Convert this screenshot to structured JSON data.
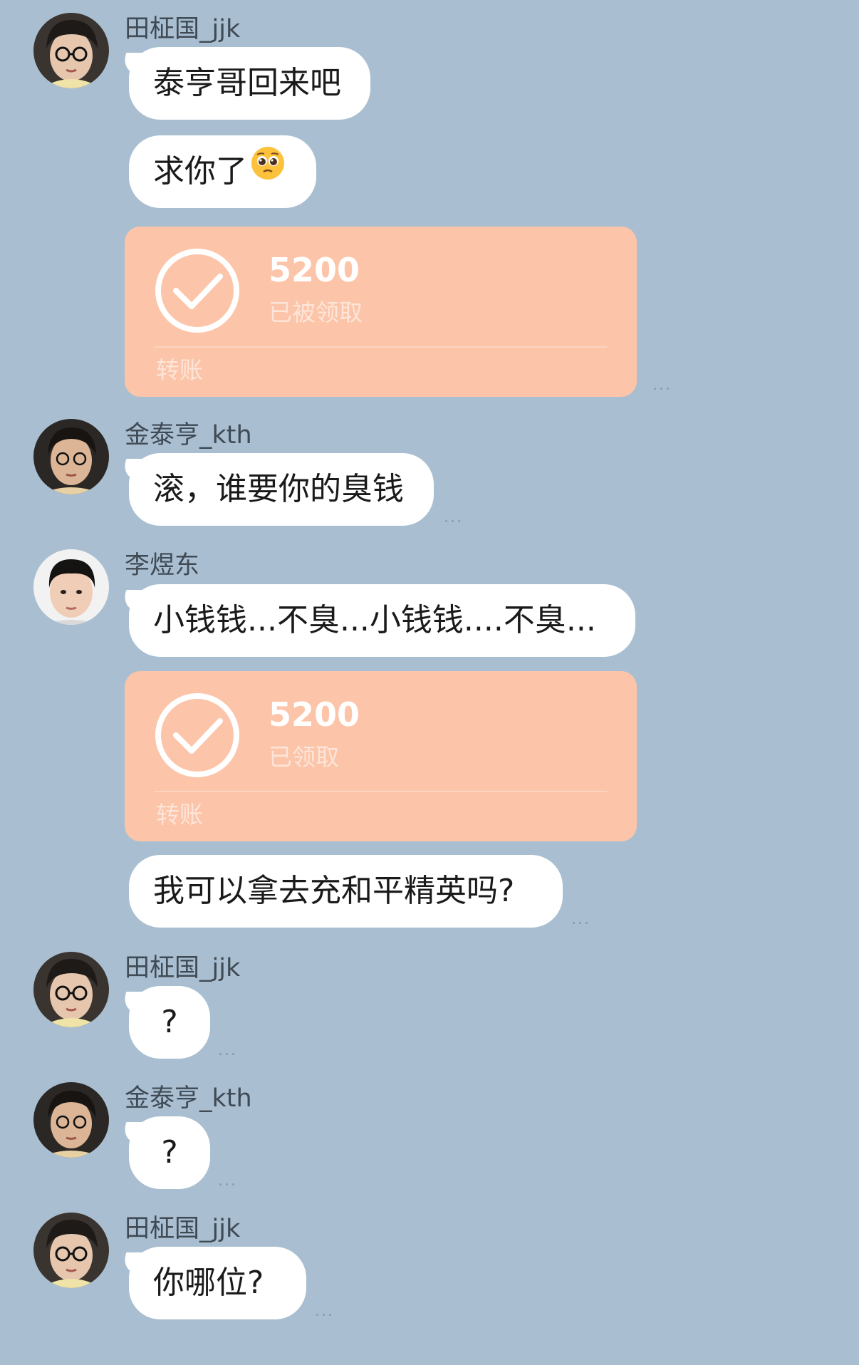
{
  "messages": [
    {
      "sender": "田柾国_jjk",
      "text": "泰亨哥回来吧"
    },
    {
      "text": "求你了",
      "emoji": "pleading-face-emoji"
    },
    {
      "transfer": {
        "amount": "5200",
        "status": "已被领取",
        "label": "转账"
      },
      "more": "..."
    },
    {
      "sender": "金泰亨_kth",
      "text": "滚，谁要你的臭钱",
      "more": "..."
    },
    {
      "sender": "李煜东",
      "text": "小钱钱...不臭...小钱钱....不臭..."
    },
    {
      "transfer": {
        "amount": "5200",
        "status": "已领取",
        "label": "转账"
      }
    },
    {
      "text": "我可以拿去充和平精英吗?",
      "more": "..."
    },
    {
      "sender": "田柾国_jjk",
      "text": "?",
      "more": "..."
    },
    {
      "sender": "金泰亨_kth",
      "text": "?",
      "more": "..."
    },
    {
      "sender": "田柾国_jjk",
      "text": "你哪位?",
      "more": "..."
    }
  ],
  "colors": {
    "background": "#a9bfd1",
    "bubble": "#ffffff",
    "transfer_card": "#fcc4a8",
    "sender_name": "#3f4a55"
  },
  "icons": {
    "transfer_status": "check-circle-icon",
    "options": "more-dots-icon"
  }
}
